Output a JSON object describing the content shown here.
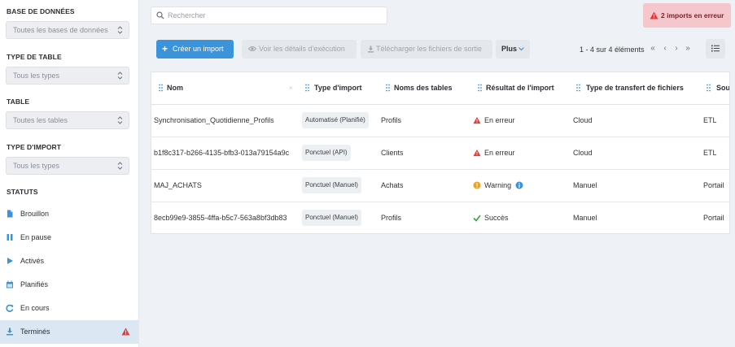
{
  "sidebar": {
    "database_label": "BASE DE DONNÉES",
    "database_value": "Toutes les bases de données",
    "table_type_label": "TYPE DE TABLE",
    "table_type_value": "Tous les types",
    "table_label": "TABLE",
    "table_value": "Toutes les tables",
    "import_type_label": "TYPE D'IMPORT",
    "import_type_value": "Tous les types",
    "statuses_label": "STATUTS",
    "statuses": [
      {
        "label": "Brouillon",
        "icon": "document-icon"
      },
      {
        "label": "En pause",
        "icon": "pause-icon"
      },
      {
        "label": "Activés",
        "icon": "play-icon"
      },
      {
        "label": "Planifiés",
        "icon": "calendar-icon"
      },
      {
        "label": "En cours",
        "icon": "refresh-icon"
      },
      {
        "label": "Terminés",
        "icon": "download-icon",
        "active": true,
        "warning": true
      }
    ]
  },
  "search": {
    "placeholder": "Rechercher"
  },
  "error_badge": "2 imports en erreur",
  "toolbar": {
    "create": "Créer un import",
    "details": "Voir les détails d'exécution",
    "download": "Télécharger les fichiers de sortie",
    "more": "Plus"
  },
  "pager": {
    "text": "1 - 4 sur 4 éléments"
  },
  "table": {
    "headers": [
      "Nom",
      "Type d'import",
      "Noms des tables",
      "Résultat de l'import",
      "Type de transfert de fichiers",
      "Sou"
    ],
    "rows": [
      {
        "name": "Synchronisation_Quotidienne_Profils",
        "type": "Automatisé (Planifié)",
        "table": "Profils",
        "result": "En erreur",
        "result_icon": "error-triangle-icon",
        "transfer": "Cloud",
        "source": "ETL"
      },
      {
        "name": "b1f8c317-b266-4135-bfb3-013a79154a9c",
        "type": "Ponctuel (API)",
        "table": "Clients",
        "result": "En erreur",
        "result_icon": "error-triangle-icon",
        "transfer": "Cloud",
        "source": "ETL"
      },
      {
        "name": "MAJ_ACHATS",
        "type": "Ponctuel (Manuel)",
        "table": "Achats",
        "result": "Warning",
        "result_icon": "warning-circle-icon",
        "transfer": "Manuel",
        "source": "Portail"
      },
      {
        "name": "8ecb99e9-3855-4ffa-b5c7-563a8bf3db83",
        "type": "Ponctuel (Manuel)",
        "table": "Profils",
        "result": "Succès",
        "result_icon": "check-icon",
        "transfer": "Manuel",
        "source": "Portail"
      }
    ]
  },
  "colors": {
    "primary": "#3b93d9",
    "error": "#e03c3c",
    "warning": "#f0a21b",
    "success": "#3aa34a",
    "active_bg": "#dbe8f4"
  }
}
